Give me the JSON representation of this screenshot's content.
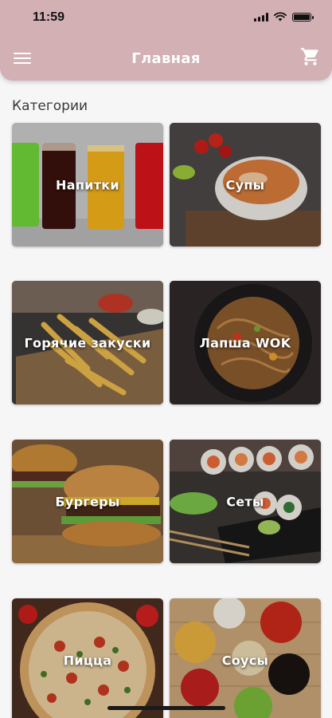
{
  "status_bar": {
    "time": "11:59"
  },
  "header": {
    "title": "Главная",
    "menu_icon": "menu-icon",
    "cart_icon": "cart-icon"
  },
  "section": {
    "title": "Категории"
  },
  "categories": [
    {
      "label": "Напитки"
    },
    {
      "label": "Супы"
    },
    {
      "label": "Горячие закуски"
    },
    {
      "label": "Лапша WOK"
    },
    {
      "label": "Бургеры"
    },
    {
      "label": "Сеты"
    },
    {
      "label": "Пицца"
    },
    {
      "label": "Соусы"
    }
  ],
  "colors": {
    "appbar": "#d2b0b4",
    "background": "#f7f6f7"
  }
}
